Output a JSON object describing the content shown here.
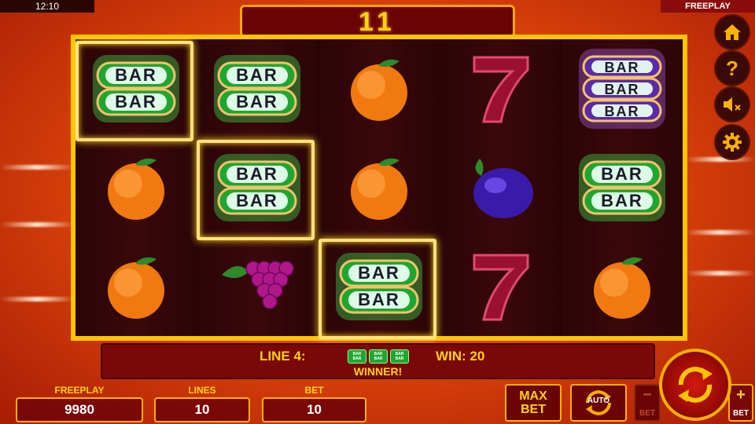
{
  "status": {
    "clock": "12:10",
    "mode": "FREEPLAY"
  },
  "header": {
    "counter": "11"
  },
  "reels": [
    [
      "bar2",
      "orange",
      "orange"
    ],
    [
      "bar2",
      "bar2",
      "grapes"
    ],
    [
      "orange",
      "orange",
      "bar2"
    ],
    [
      "seven",
      "plum",
      "seven"
    ],
    [
      "bar3",
      "bar2",
      "orange"
    ]
  ],
  "symbols": {
    "bar_text": "BAR"
  },
  "side_buttons": [
    "home-icon",
    "help-icon",
    "sound-muted-icon",
    "settings-icon"
  ],
  "info": {
    "line": "LINE 4:",
    "win": "WIN: 20",
    "winner": "WINNER!"
  },
  "fields": {
    "credit_title": "FREEPLAY",
    "credit_value": "9980",
    "lines_title": "LINES",
    "lines_value": "10",
    "bet_title": "BET",
    "bet_value": "10"
  },
  "controls": {
    "max": "MAX",
    "bet": "BET",
    "auto": "AUTO",
    "minus": "−",
    "plus": "+",
    "minus_label": "BET",
    "plus_label": "BET"
  },
  "colors": {
    "accent": "#ffd21a",
    "frame": "#ffc400",
    "panel": "#7a0808",
    "bar_green": "#1fa630",
    "bar_purple": "#5a2aa8"
  }
}
